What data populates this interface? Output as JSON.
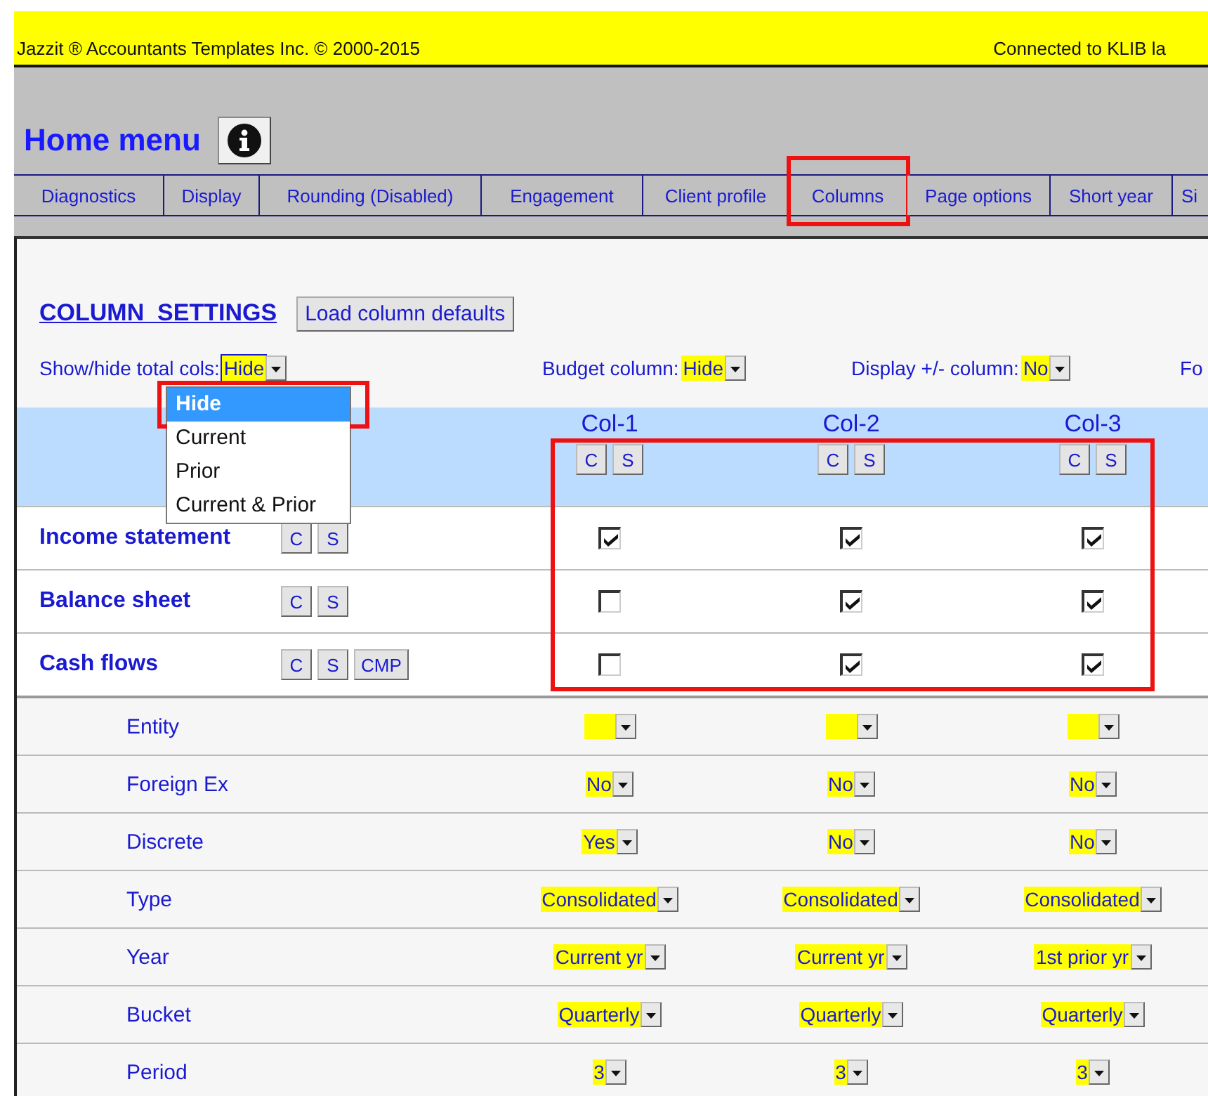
{
  "banner": {
    "left": "Jazzit ®  Accountants Templates Inc.  © 2000-2015",
    "right": "Connected to KLIB la"
  },
  "header": {
    "title": "Home menu"
  },
  "tabs": [
    {
      "label": "Diagnostics",
      "selected": false
    },
    {
      "label": "Display",
      "selected": false
    },
    {
      "label": "Rounding (Disabled)",
      "selected": false
    },
    {
      "label": "Engagement",
      "selected": false
    },
    {
      "label": "Client profile",
      "selected": false
    },
    {
      "label": "Columns",
      "selected": true
    },
    {
      "label": "Page options",
      "selected": false
    },
    {
      "label": "Short year",
      "selected": false
    },
    {
      "label": "Si",
      "selected": false
    }
  ],
  "settings": {
    "title": "COLUMN  SETTINGS",
    "load_button": "Load column defaults",
    "options": [
      {
        "label": "Show/hide total cols:",
        "value": "Hide",
        "open": true
      },
      {
        "label": "Budget column:",
        "value": "Hide",
        "open": false
      },
      {
        "label": "Display +/- column:",
        "value": "No",
        "open": false
      },
      {
        "label": "Fo"
      }
    ]
  },
  "total_cols_menu": [
    {
      "label": "Hide",
      "selected": true,
      "highlighted": true
    },
    {
      "label": "Current",
      "selected": false,
      "highlighted": false
    },
    {
      "label": "Prior",
      "selected": false,
      "highlighted": false
    },
    {
      "label": "Current & Prior",
      "selected": false,
      "highlighted": false
    }
  ],
  "columns": [
    {
      "name": "Col-1",
      "buttons": [
        "C",
        "S"
      ]
    },
    {
      "name": "Col-2",
      "buttons": [
        "C",
        "S"
      ]
    },
    {
      "name": "Col-3",
      "buttons": [
        "C",
        "S"
      ]
    }
  ],
  "statements": [
    {
      "name": "Income statement",
      "buttons": [
        "C",
        "S"
      ],
      "checked": [
        true,
        true,
        true
      ]
    },
    {
      "name": "Balance sheet",
      "buttons": [
        "C",
        "S"
      ],
      "checked": [
        false,
        true,
        true
      ]
    },
    {
      "name": "Cash flows",
      "buttons": [
        "C",
        "S",
        "CMP"
      ],
      "checked": [
        false,
        true,
        true
      ]
    }
  ],
  "checkbox_grid_highlighted": true,
  "properties": [
    {
      "name": "Entity",
      "cells": [
        {},
        {},
        {}
      ]
    },
    {
      "name": "Foreign Ex",
      "cells": [
        {
          "value": "No"
        },
        {
          "value": "No"
        },
        {
          "value": "No"
        }
      ]
    },
    {
      "name": "Discrete",
      "cells": [
        {
          "value": "Yes"
        },
        {
          "value": "No"
        },
        {
          "value": "No"
        }
      ]
    },
    {
      "name": "Type",
      "cells": [
        {
          "value": "Consolidated"
        },
        {
          "value": "Consolidated"
        },
        {
          "value": "Consolidated"
        }
      ]
    },
    {
      "name": "Year",
      "cells": [
        {
          "value": "Current yr"
        },
        {
          "value": "Current yr"
        },
        {
          "value": "1st prior yr"
        }
      ]
    },
    {
      "name": "Bucket",
      "cells": [
        {
          "value": "Quarterly"
        },
        {
          "value": "Quarterly"
        },
        {
          "value": "Quarterly"
        }
      ]
    },
    {
      "name": "Period",
      "cells": [
        {
          "value": "3"
        },
        {
          "value": "3"
        },
        {
          "value": "3"
        }
      ]
    }
  ]
}
